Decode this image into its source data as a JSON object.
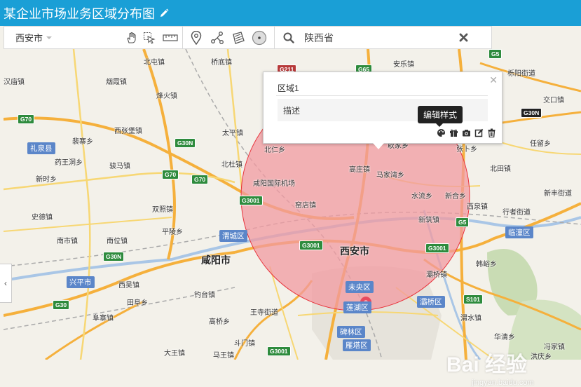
{
  "title": "某企业市场业务区域分布图",
  "toolbar": {
    "city": "西安市",
    "search_value": "陕西省",
    "tools": [
      "hand-icon",
      "pointer-select-icon",
      "ruler-icon",
      "marker-icon",
      "polyline-icon",
      "polygon-icon",
      "circle-icon"
    ]
  },
  "popup": {
    "region_name": "区域1",
    "description": "描述",
    "tooltip": "编辑样式"
  },
  "colors": {
    "accent": "#1a9fd6",
    "circle_fill": "#f29aa0",
    "circle_stroke": "#e8323a",
    "district_badge": "#5b86c9",
    "marker": "#e84a5f"
  },
  "map": {
    "places": [
      {
        "name": "北屯镇"
      },
      {
        "name": "桥底镇"
      },
      {
        "name": "烟霞镇"
      },
      {
        "name": "烽火镇"
      },
      {
        "name": "西张堡镇"
      },
      {
        "name": "太平镇"
      },
      {
        "name": "裴寨乡"
      },
      {
        "name": "药王洞乡"
      },
      {
        "name": "骏马镇"
      },
      {
        "name": "北杜镇"
      },
      {
        "name": "新时乡"
      },
      {
        "name": "双照镇"
      },
      {
        "name": "史德镇"
      },
      {
        "name": "平陵乡"
      },
      {
        "name": "南市镇"
      },
      {
        "name": "南位镇"
      },
      {
        "name": "西吴镇"
      },
      {
        "name": "钓台镇"
      },
      {
        "name": "田阜乡"
      },
      {
        "name": "阜寨镇"
      },
      {
        "name": "王寺街道"
      },
      {
        "name": "高桥乡"
      },
      {
        "name": "斗门镇"
      },
      {
        "name": "大王镇"
      },
      {
        "name": "马王镇"
      },
      {
        "name": "北仁乡"
      },
      {
        "name": "高庄镇"
      },
      {
        "name": "咸阳国际机场"
      },
      {
        "name": "窑店镇"
      },
      {
        "name": "马家湾乡"
      },
      {
        "name": "水流乡"
      },
      {
        "name": "新合乡"
      },
      {
        "name": "新筑镇"
      },
      {
        "name": "灞桥镇"
      },
      {
        "name": "安乐镇"
      },
      {
        "name": "栎阳街道"
      },
      {
        "name": "交口镇"
      },
      {
        "name": "任留乡"
      },
      {
        "name": "北田镇"
      },
      {
        "name": "新丰街道"
      },
      {
        "name": "西泉镇"
      },
      {
        "name": "行者街道"
      },
      {
        "name": "韩峪乡"
      },
      {
        "name": "渭水镇"
      },
      {
        "name": "华清乡"
      },
      {
        "name": "冯家镇"
      },
      {
        "name": "洪庆乡"
      },
      {
        "name": "汉庙镇"
      },
      {
        "name": "张卜乡"
      },
      {
        "name": "耿家乡"
      }
    ],
    "cities": [
      "西安市",
      "咸阳市"
    ],
    "districts": [
      "礼泉县",
      "渭城区",
      "兴平市",
      "未央区",
      "莲湖区",
      "碑林区",
      "雁塔区",
      "灞桥区",
      "临潼区"
    ],
    "road_shields": [
      "G70",
      "G30N",
      "G70",
      "G70",
      "G211",
      "G65",
      "G5",
      "G30N",
      "G3001",
      "G3001",
      "G3001",
      "G30N",
      "G30",
      "G5",
      "S101",
      "G3001"
    ]
  },
  "watermark": {
    "text": "Bai 经验",
    "sub": "jingyan.baidu.com"
  }
}
